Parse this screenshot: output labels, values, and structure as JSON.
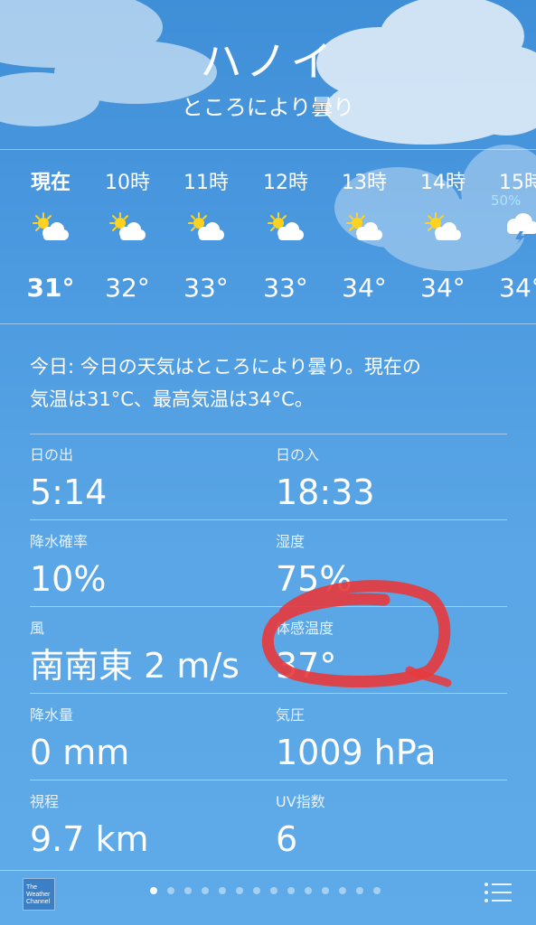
{
  "header": {
    "city": "ハノイ",
    "condition": "ところにより曇り"
  },
  "hourly": [
    {
      "time": "現在",
      "temp": "31°",
      "icon": "partly-cloudy-icon",
      "now": true
    },
    {
      "time": "10時",
      "temp": "32°",
      "icon": "partly-cloudy-icon"
    },
    {
      "time": "11時",
      "temp": "33°",
      "icon": "partly-cloudy-icon"
    },
    {
      "time": "12時",
      "temp": "33°",
      "icon": "partly-cloudy-icon"
    },
    {
      "time": "13時",
      "temp": "34°",
      "icon": "partly-cloudy-icon"
    },
    {
      "time": "14時",
      "temp": "34°",
      "icon": "partly-cloudy-icon"
    },
    {
      "time": "15時",
      "temp": "34°",
      "icon": "thunderstorm-icon",
      "precip": "50%"
    }
  ],
  "summary": {
    "line1": "今日: 今日の天気はところにより曇り。現在の",
    "line2": "気温は31°C、最高気温は34°C。"
  },
  "details": {
    "sunrise": {
      "label": "日の出",
      "value": "5:14"
    },
    "sunset": {
      "label": "日の入",
      "value": "18:33"
    },
    "precip_chance": {
      "label": "降水確率",
      "value": "10%"
    },
    "humidity": {
      "label": "湿度",
      "value": "75%"
    },
    "wind": {
      "label": "風",
      "value": "南南東 2 m/s"
    },
    "feels_like": {
      "label": "体感温度",
      "value": "37°"
    },
    "precipitation": {
      "label": "降水量",
      "value": "0 mm"
    },
    "pressure": {
      "label": "気圧",
      "value": "1009 hPa"
    },
    "visibility": {
      "label": "視程",
      "value": "9.7 km"
    },
    "uv_index": {
      "label": "UV指数",
      "value": "6"
    }
  },
  "footer": {
    "logo_text": [
      "The",
      "Weather",
      "Channel"
    ],
    "page_count": 14,
    "active_page": 0
  },
  "annotation": {
    "color": "#e8383a"
  },
  "colors": {
    "sun": "#ffd21f",
    "precip": "#aee2ff"
  }
}
